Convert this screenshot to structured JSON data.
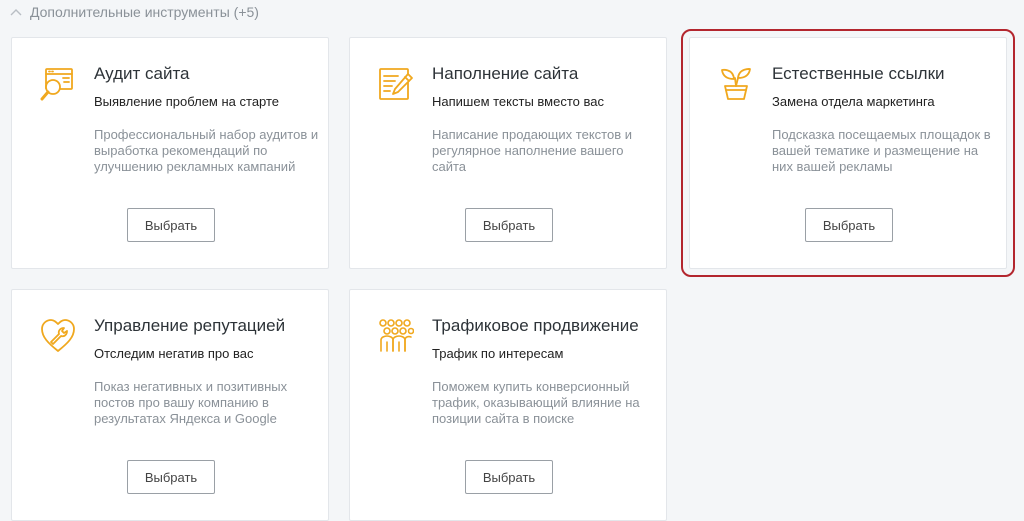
{
  "section": {
    "title": "Дополнительные инструменты (+5)"
  },
  "accent_color": "#f0a81e",
  "selected_outline_color": "#b3262e",
  "cards": [
    {
      "icon": "site-audit-magnifier-icon",
      "title": "Аудит сайта",
      "subtitle": "Выявление проблем на старте",
      "description": "Профессиональный набор аудитов и выработка рекомендаций по улучшению рекламных кампаний",
      "button": "Выбрать"
    },
    {
      "icon": "document-edit-pencil-icon",
      "title": "Наполнение сайта",
      "subtitle": "Напишем тексты вместо вас",
      "description": "Написание продающих текстов и регулярное наполнение вашего сайта",
      "button": "Выбрать"
    },
    {
      "icon": "plant-pot-icon",
      "title": "Естественные ссылки",
      "subtitle": "Замена отдела маркетинга",
      "description": "Подсказка посещаемых площадок в вашей тематике и размещение на них вашей рекламы",
      "button": "Выбрать"
    },
    {
      "icon": "heart-wrench-icon",
      "title": "Управление репутацией",
      "subtitle": "Отследим негатив про вас",
      "description": "Показ негативных и позитивных постов про вашу компанию в результатах Яндекса и Google",
      "button": "Выбрать"
    },
    {
      "icon": "people-audience-icon",
      "title": "Трафиковое продвижение",
      "subtitle": "Трафик по интересам",
      "description": "Поможем купить конверсионный трафик, оказывающий влияние на позиции сайта в поиске",
      "button": "Выбрать"
    }
  ]
}
